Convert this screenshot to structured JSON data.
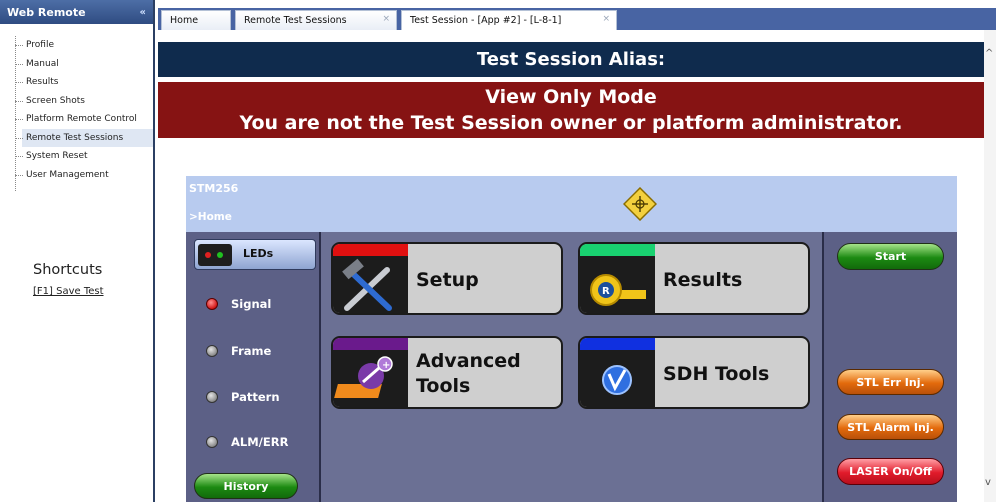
{
  "sidebar": {
    "title": "Web Remote",
    "collapse_glyph": "«",
    "items": [
      {
        "label": "Profile"
      },
      {
        "label": "Manual"
      },
      {
        "label": "Results"
      },
      {
        "label": "Screen Shots"
      },
      {
        "label": "Platform Remote Control"
      },
      {
        "label": "Remote Test Sessions",
        "selected": true
      },
      {
        "label": "System Reset"
      },
      {
        "label": "User Management"
      }
    ],
    "shortcuts_title": "Shortcuts",
    "shortcut_save": "[F1] Save Test"
  },
  "tabs": [
    {
      "label": "Home"
    },
    {
      "label": "Remote Test Sessions",
      "close": "×"
    },
    {
      "label": "Test Session - [App #2] - [L-8-1]",
      "close": "×",
      "active": true
    }
  ],
  "alias_bar": {
    "text": "Test Session Alias:"
  },
  "view_only": {
    "line1": "View Only Mode",
    "line2": "You are not the Test Session owner or platform administrator."
  },
  "instrument": {
    "model": "STM256",
    "breadcrumb": ">Home",
    "leds_label": "LEDs",
    "leds": [
      {
        "label": "Signal",
        "state": "red"
      },
      {
        "label": "Frame",
        "state": "off"
      },
      {
        "label": "Pattern",
        "state": "off"
      },
      {
        "label": "ALM/ERR",
        "state": "off"
      }
    ],
    "history_label": "History",
    "tiles": {
      "setup": {
        "label": "Setup",
        "strip_color": "#e01010",
        "icon": "tools-icon"
      },
      "results": {
        "label": "Results",
        "strip_color": "#19d170",
        "icon": "tape-measure-icon"
      },
      "advanced": {
        "line1": "Advanced",
        "line2": "Tools",
        "strip_color": "#6a1a8c",
        "icon": "advanced-tools-icon"
      },
      "sdh": {
        "label": "SDH Tools",
        "strip_color": "#1030e0",
        "icon": "sdh-logo-icon"
      }
    },
    "right_buttons": {
      "start": "Start",
      "stl_err": "STL Err Inj.",
      "stl_alarm": "STL Alarm Inj.",
      "laser": "LASER On/Off"
    }
  },
  "colors": {
    "alias_bar": "#0f2b4d",
    "banner": "#861313",
    "tab_bar": "#4864a3",
    "panel_header": "#b8cbef",
    "panel_body": "#6b7094"
  }
}
